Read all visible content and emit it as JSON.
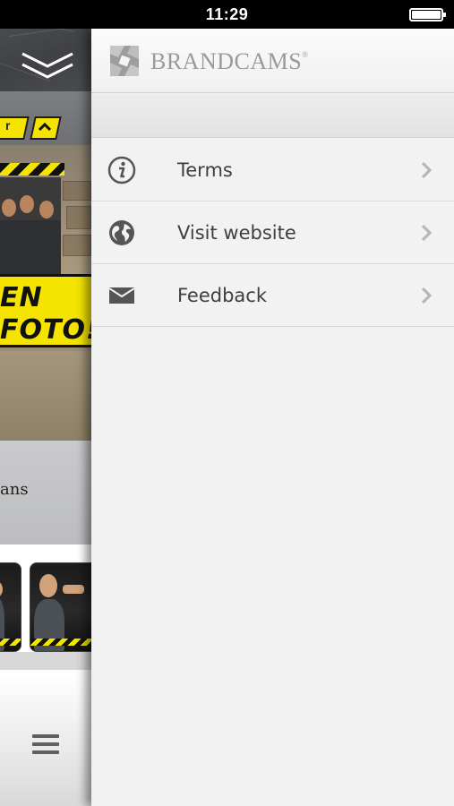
{
  "status_bar": {
    "time": "11:29",
    "battery_icon": "battery-full-icon"
  },
  "background_app": {
    "header_icon": "double-chevron-down-icon",
    "tag_text": "r",
    "banner_line1": "EN",
    "banner_line2": "FOTO!",
    "partial_text": "ans",
    "menu_icon": "hamburger-menu-icon",
    "accent_color": "#f4e400"
  },
  "drawer": {
    "brand": {
      "name": "BRANDCAMS",
      "registered_mark": "®"
    },
    "items": [
      {
        "label": "Terms",
        "icon": "info-icon"
      },
      {
        "label": "Visit website",
        "icon": "globe-icon"
      },
      {
        "label": "Feedback",
        "icon": "envelope-icon"
      }
    ],
    "chevron_icon": "chevron-right-icon",
    "colors": {
      "background": "#f1f1f1",
      "text": "#3f3f3f",
      "brand_gray": "#9a9a9a"
    }
  }
}
